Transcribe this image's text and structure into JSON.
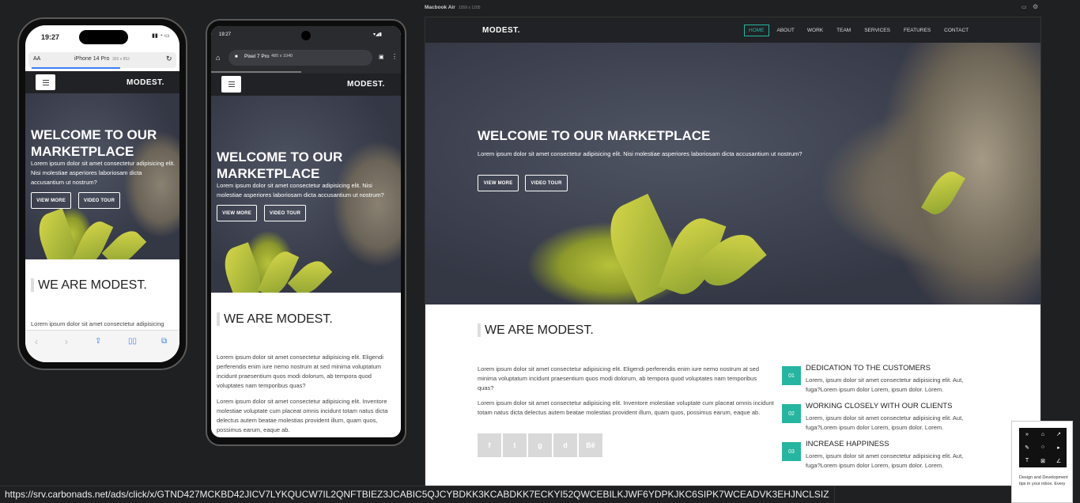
{
  "phone1": {
    "time": "19:27",
    "url_aa": "AA",
    "device_label": "iPhone 14 Pro",
    "device_dims": "393 x 852",
    "logo": "MODEST.",
    "hero_title": "WELCOME TO OUR MARKETPLACE",
    "hero_text": "Lorem ipsum dolor sit amet consectetur adipisicing elit. Nisi molestiae asperiores laboriosam dicta accusantium ut nostrum?",
    "btn_view_more": "VIEW MORE",
    "btn_video_tour": "VIDEO TOUR",
    "section_title": "WE ARE MODEST.",
    "para": "Lorem ipsum dolor sit amet consectetur adipisicing"
  },
  "phone2": {
    "time": "19:27",
    "device_label": "Pixel 7 Pro",
    "device_dims": "480 x 1040",
    "logo": "MODEST.",
    "hero_title": "WELCOME TO OUR MARKETPLACE",
    "hero_text": "Lorem ipsum dolor sit amet consectetur adipisicing elit. Nisi molestiae asperiores laboriosam dicta accusantium ut nostrum?",
    "btn_view_more": "VIEW MORE",
    "btn_video_tour": "VIDEO TOUR",
    "section_title": "WE ARE MODEST.",
    "para1": "Lorem ipsum dolor sit amet consectetur adipisicing elit. Eligendi perferendis enim iure nemo nostrum at sed minima voluptatum incidunt praesentium quos modi dolorum, ab tempora quod voluptates nam temporibus quas?",
    "para2": "Lorem ipsum dolor sit amet consectetur adipisicing elit. Inventore molestiae voluptate cum placeat omnis incidunt totam natus dicta delectus autem beatae molestias provident illum, quam quos, possimus earum, eaque ab."
  },
  "desktop": {
    "device_label": "Macbook Air",
    "device_dims": "1559 x 1205",
    "logo": "MODEST.",
    "nav": [
      "HOME",
      "ABOUT",
      "WORK",
      "TEAM",
      "SERVICES",
      "FEATURES",
      "CONTACT"
    ],
    "hero_title": "WELCOME TO OUR MARKETPLACE",
    "hero_text": "Lorem ipsum dolor sit amet consectetur adipisicing elit. Nisi molestiae asperiores laboriosam dicta accusantium ut nostrum?",
    "btn_view_more": "VIEW MORE",
    "btn_video_tour": "VIDEO TOUR",
    "section_title": "WE ARE MODEST.",
    "para1": "Lorem ipsum dolor sit amet consectetur adipisicing elit. Eligendi perferendis enim iure nemo nostrum at sed minima voluptatum incidunt praesentium quos modi dolorum, ab tempora quod voluptates nam temporibus quas?",
    "para2": "Lorem ipsum dolor sit amet consectetur adipisicing elit. Inventore molestiae voluptate cum placeat omnis incidunt totam natus dicta delectus autem beatae molestias provident illum, quam quos, possimus earum, eaque ab.",
    "social": [
      "f",
      "t",
      "g",
      "d",
      "Bē"
    ],
    "features": [
      {
        "num": "01",
        "title": "DEDICATION TO THE CUSTOMERS",
        "text": "Lorem, ipsum dolor sit amet consectetur adipisicing elit. Aut, fuga?Lorem ipsum dolor Lorem, ipsum dolor. Lorem."
      },
      {
        "num": "02",
        "title": "WORKING CLOSELY WITH OUR CLIENTS",
        "text": "Lorem, ipsum dolor sit amet consectetur adipisicing elit. Aut, fuga?Lorem ipsum dolor Lorem, ipsum dolor. Lorem."
      },
      {
        "num": "03",
        "title": "INCREASE HAPPINESS",
        "text": "Lorem, ipsum dolor sit amet consectetur adipisicing elit. Aut, fuga?Lorem ipsum dolor Lorem, ipsum dolor. Lorem."
      }
    ]
  },
  "ad": {
    "text": "Design and Development tips in your inbox. Every"
  },
  "status_url": "https://srv.carbonads.net/ads/click/x/GTND427MCKBD42JICV7LYKQUCW7IL2QNFTBIEZ3JCABIC5QJCYBDKK3KCABDKK7ECKYI52QWCEBILKJWF6YDPKJKC6SIPK7WCEADVK3EHJNCLSIZ",
  "colors": {
    "accent": "#26b5a0",
    "background": "#1f2022",
    "nav_bg": "#202225"
  }
}
